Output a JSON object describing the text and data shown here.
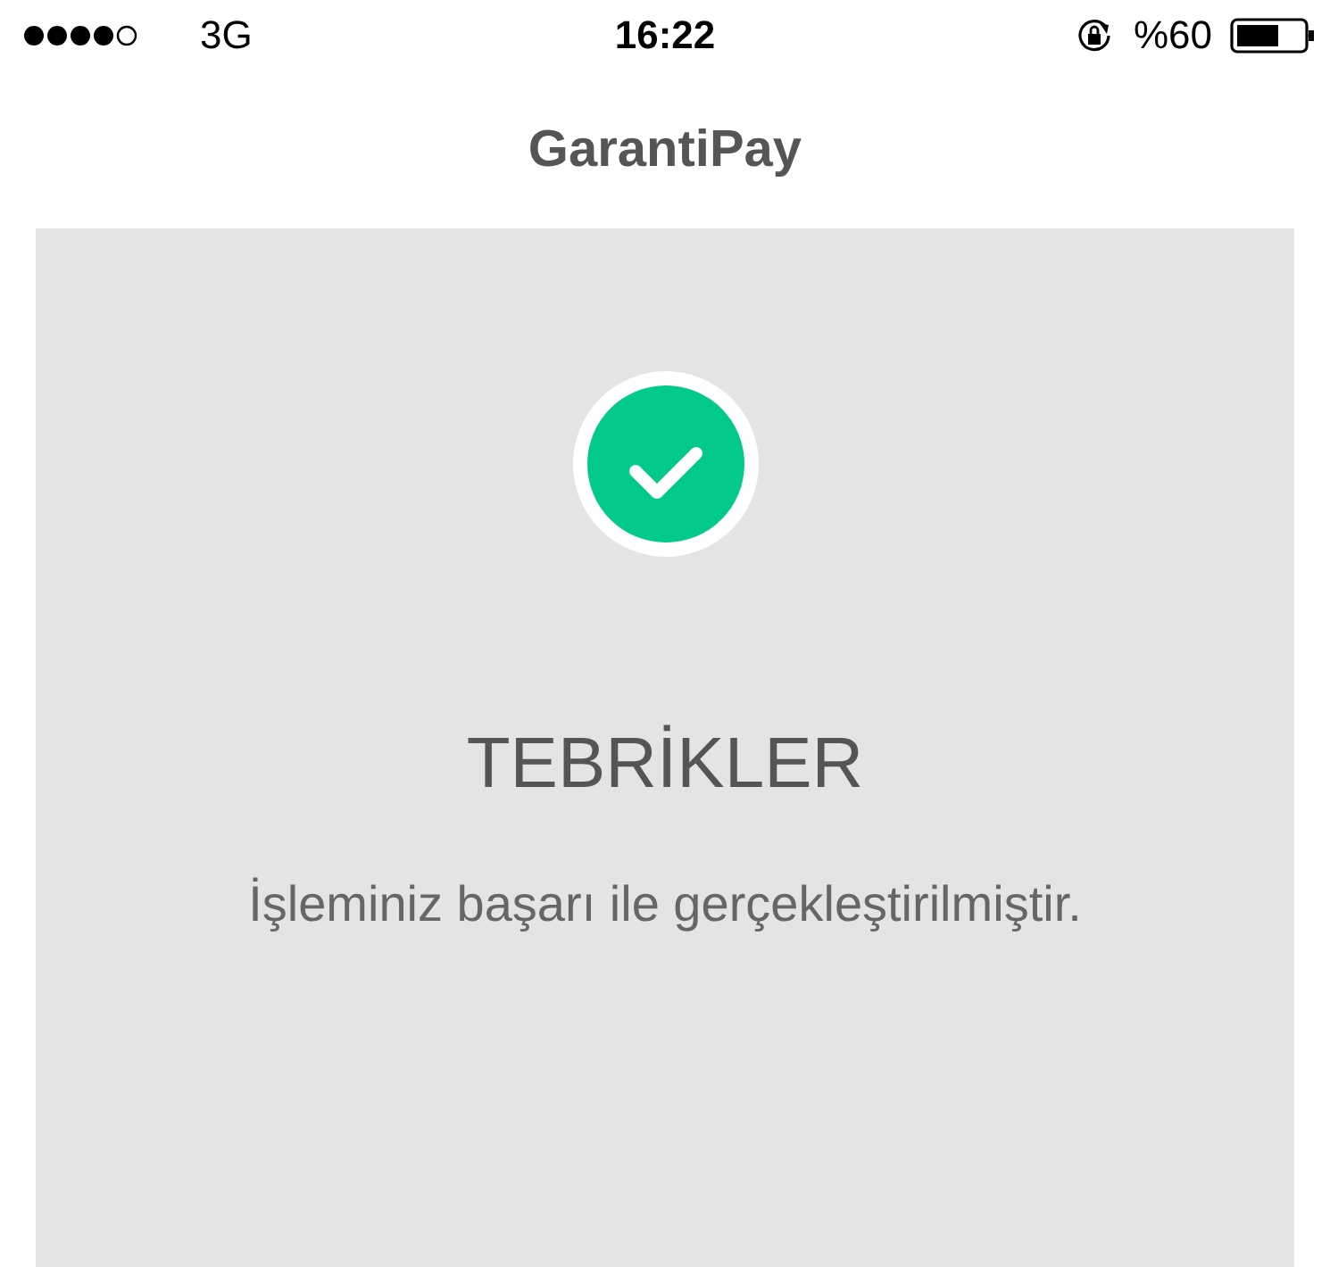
{
  "status_bar": {
    "carrier": "3G",
    "time": "16:22",
    "battery": "%60"
  },
  "nav": {
    "title": "GarantiPay"
  },
  "result": {
    "heading": "TEBRİKLER",
    "message": "İşleminiz başarı ile gerçekleştirilmiştir."
  }
}
